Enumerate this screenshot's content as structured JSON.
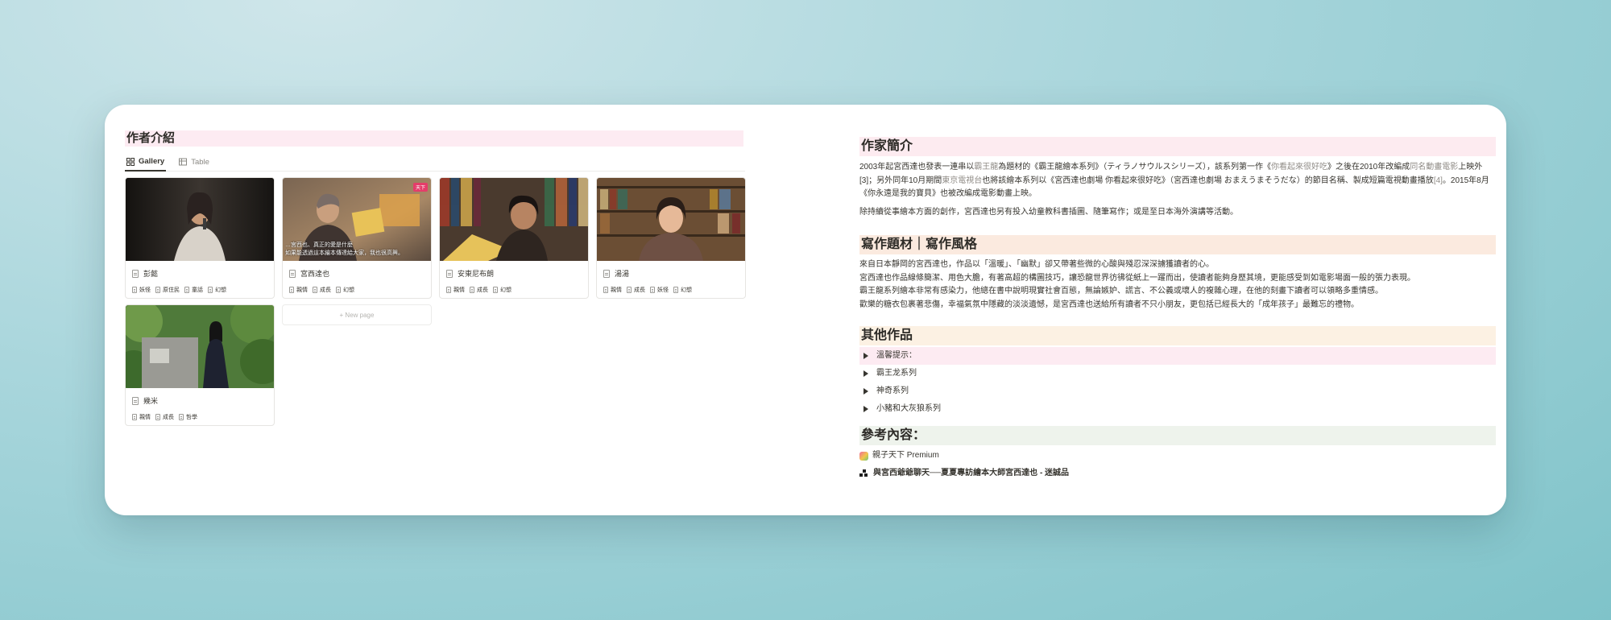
{
  "left": {
    "title": "作者介紹",
    "tabs": [
      {
        "label": "Gallery",
        "icon": "gallery-grid-icon",
        "active": true
      },
      {
        "label": "Table",
        "icon": "table-icon",
        "active": false
      }
    ],
    "cards": [
      {
        "name": "彭懿",
        "tags": [
          "妖怪",
          "原住民",
          "童話",
          "幻想"
        ]
      },
      {
        "name": "宮西達也",
        "tags": [
          "親情",
          "成長",
          "幻想"
        ],
        "caption_1": "…宮西也、真正的愛是什麼",
        "caption_2": "如果能透過這本繪本傳達給大家，我也很高興。",
        "badge": "天下"
      },
      {
        "name": "安東尼布朗",
        "tags": [
          "親情",
          "成長",
          "幻想"
        ]
      },
      {
        "name": "湯湯",
        "tags": [
          "親情",
          "成長",
          "妖怪",
          "幻想"
        ]
      },
      {
        "name": "幾米",
        "tags": [
          "親情",
          "成長",
          "哲學"
        ]
      }
    ],
    "new_page": "+ New page"
  },
  "right": {
    "intro_heading": "作家簡介",
    "intro_p1_parts": [
      "2003年起宮西達也發表一連串以",
      "霸王龍",
      "為題材的《霸王龍繪本系列》（ティラノサウルスシリーズ），該系列第一作《",
      "你看起來很好吃",
      "》之後在2010年改編成",
      "同名動畫電影",
      "上映外[3]；另外同年10月期間",
      "東京電視台",
      "也將該繪本系列以《宮西達也劇場 你看起來很好吃》（宮西達也劇場 おまえうまそうだな）的節目名稱、製成短篇電視動畫播放",
      "[4]",
      "。2015年8月《你永遠是我的寶貝》也被改編成電影動畫上映。"
    ],
    "intro_p2": "除持續從事繪本方面的創作，宮西達也另有投入幼童教科書插圖、隨筆寫作；或是至日本海外演講等活動。",
    "style_heading": "寫作題材｜寫作風格",
    "style_lines": [
      "來自日本靜岡的宮西達也，作品以「溫暖」、「幽默」卻又帶著些微的心酸與殘忍深深擄獲讀者的心。",
      "宮西達也作品線條簡潔、用色大膽，有著高超的構圖技巧，讓恐龍世界彷彿從紙上一躍而出，使讀者能夠身歷其境，更能感受到如電影場面一般的張力表現。",
      "霸王龍系列繪本非常有感染力，他總在書中說明現實社會百態，無論嫉妒、謊言、不公義或壞人的複雜心理，在他的刻畫下讀者可以領略多重情感。",
      "歡樂的糖衣包裹著悲傷，幸福氣氛中隱藏的淡淡遺憾，是宮西達也送給所有讀者不只小朋友，更包括已經長大的「成年孩子」最難忘的禮物。"
    ],
    "works_heading": "其他作品",
    "toggles": [
      "溫馨提示：",
      "霸王龙系列",
      "神奇系列",
      "小豬和大灰狼系列"
    ],
    "ref_heading": "參考內容：",
    "refs": [
      {
        "label": "親子天下 Premium",
        "icon": "parenting-app-icon"
      },
      {
        "label": "與宮西爺爺聊天──夏夏專訪繪本大師宮西達也 - 迷誠品",
        "icon": "eslite-logo-icon"
      }
    ]
  },
  "colors": {
    "background_teal": "#8fcbd1",
    "pink_highlight": "#fdebf2",
    "peach_highlight": "#fbeadf",
    "cream_highlight": "#fcf1e3",
    "green_highlight": "#eef3ec"
  }
}
